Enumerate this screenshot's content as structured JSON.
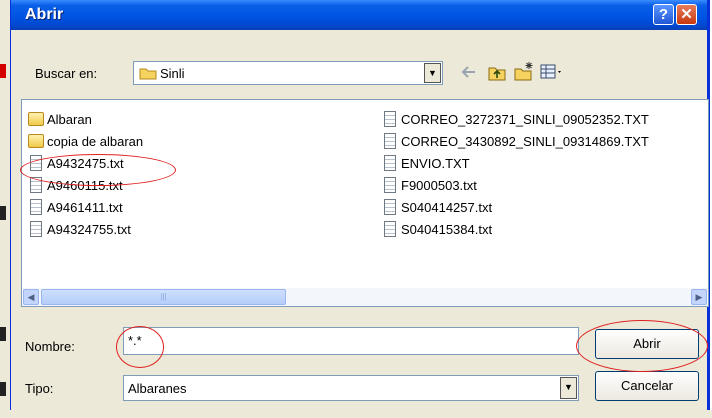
{
  "dialog": {
    "title": "Abrir",
    "help_glyph": "?",
    "close_glyph": "✕"
  },
  "location": {
    "label": "Buscar en:",
    "value": "Sinli"
  },
  "toolbar_icons": [
    "back-arrow-icon",
    "up-folder-icon",
    "new-folder-icon",
    "views-menu-icon"
  ],
  "files_left": [
    {
      "name": "Albaran",
      "type": "folder"
    },
    {
      "name": "copia de albaran",
      "type": "folder"
    },
    {
      "name": "A9432475.txt",
      "type": "file"
    },
    {
      "name": "A9460115.txt",
      "type": "file"
    },
    {
      "name": "A9461411.txt",
      "type": "file"
    },
    {
      "name": "A94324755.txt",
      "type": "file"
    }
  ],
  "files_right": [
    {
      "name": "CORREO_3272371_SINLI_09052352.TXT",
      "type": "file"
    },
    {
      "name": "CORREO_3430892_SINLI_09314869.TXT",
      "type": "file"
    },
    {
      "name": "ENVIO.TXT",
      "type": "file"
    },
    {
      "name": "F9000503.txt",
      "type": "file"
    },
    {
      "name": "S040414257.txt",
      "type": "file"
    },
    {
      "name": "S040415384.txt",
      "type": "file"
    }
  ],
  "filename": {
    "label": "Nombre:",
    "value": "*.*"
  },
  "filetype": {
    "label": "Tipo:",
    "value": "Albaranes"
  },
  "buttons": {
    "open": "Abrir",
    "cancel": "Cancelar"
  },
  "colors": {
    "title_bar": "#0054e3",
    "annotation": "#e02020"
  }
}
